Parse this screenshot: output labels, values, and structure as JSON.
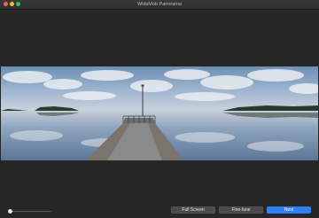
{
  "window": {
    "title": "WidsMob Panorama"
  },
  "buttons": {
    "full_screen": "Full Screen",
    "fine_tune": "Fine-tune",
    "next": "Next"
  },
  "colors": {
    "accent": "#2f7ff6",
    "background": "#262626"
  },
  "zoom": {
    "level": 0
  },
  "image": {
    "subject": "panorama-lake-pier"
  }
}
